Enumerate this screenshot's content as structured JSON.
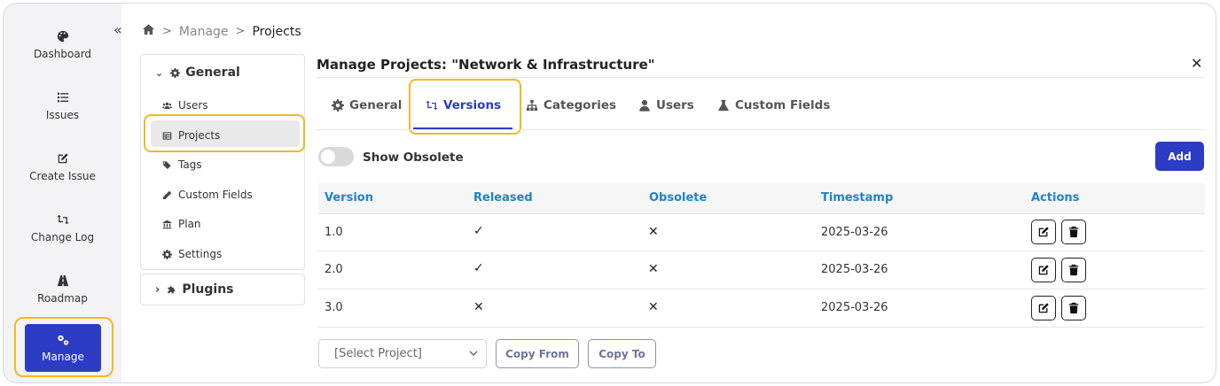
{
  "nav": {
    "items": [
      {
        "label": "Dashboard",
        "icon": "palette-icon"
      },
      {
        "label": "Issues",
        "icon": "list-icon"
      },
      {
        "label": "Create Issue",
        "icon": "edit-icon"
      },
      {
        "label": "Change Log",
        "icon": "arrows-icon"
      },
      {
        "label": "Roadmap",
        "icon": "road-icon"
      }
    ],
    "manage": {
      "label": "Manage",
      "icon": "gears-icon"
    },
    "collapse_glyph": "«"
  },
  "breadcrumb": {
    "level1": "Manage",
    "level2": "Projects",
    "sep": ">"
  },
  "menu": {
    "general": {
      "label": "General",
      "chevron": "⌄"
    },
    "items": [
      {
        "label": "Users",
        "icon": "users-icon"
      },
      {
        "label": "Projects",
        "icon": "table-icon"
      },
      {
        "label": "Tags",
        "icon": "tags-icon"
      },
      {
        "label": "Custom Fields",
        "icon": "pencil-icon"
      },
      {
        "label": "Plan",
        "icon": "bank-icon"
      },
      {
        "label": "Settings",
        "icon": "gear-icon"
      }
    ],
    "plugins": {
      "label": "Plugins",
      "chevron": "›"
    }
  },
  "panel": {
    "title": "Manage Projects: \"Network & Infrastructure\"",
    "close": "✕",
    "tabs": [
      {
        "label": "General"
      },
      {
        "label": "Versions"
      },
      {
        "label": "Categories"
      },
      {
        "label": "Users"
      },
      {
        "label": "Custom Fields"
      }
    ],
    "show_obsolete_label": "Show Obsolete",
    "add_label": "Add"
  },
  "table": {
    "headers": [
      "Version",
      "Released",
      "Obsolete",
      "Timestamp",
      "Actions"
    ],
    "rows": [
      {
        "version": "1.0",
        "released": "✓",
        "obsolete": "✕",
        "timestamp": "2025-03-26"
      },
      {
        "version": "2.0",
        "released": "✓",
        "obsolete": "✕",
        "timestamp": "2025-03-26"
      },
      {
        "version": "3.0",
        "released": "✕",
        "obsolete": "✕",
        "timestamp": "2025-03-26"
      }
    ]
  },
  "bottom": {
    "select_value": "[Select Project]",
    "copy_from": "Copy From",
    "copy_to": "Copy To"
  },
  "colors": {
    "accent": "#2c3cc4",
    "highlight": "#f2b824",
    "header_text": "#1f84c4"
  }
}
